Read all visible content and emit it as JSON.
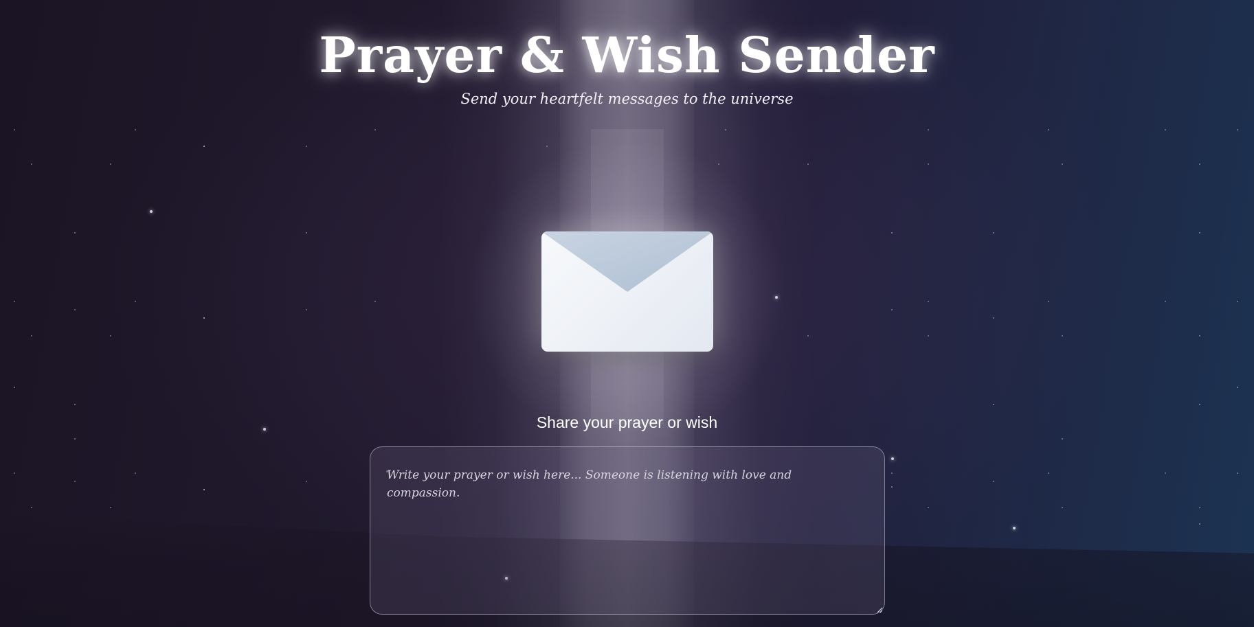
{
  "header": {
    "title": "Prayer & Wish Sender",
    "subtitle": "Send your heartfelt messages to the universe"
  },
  "envelope": {
    "icon": "envelope-icon"
  },
  "form": {
    "label": "Share your prayer or wish",
    "message_placeholder": "Write your prayer or wish here... Someone is listening with love and compassion.",
    "message_value": ""
  },
  "colors": {
    "background_dark": "#1a1424",
    "background_blue": "#1c3352",
    "envelope_body": "#eef1f6",
    "envelope_flap": "#b7c6d8",
    "text": "#ffffff"
  }
}
